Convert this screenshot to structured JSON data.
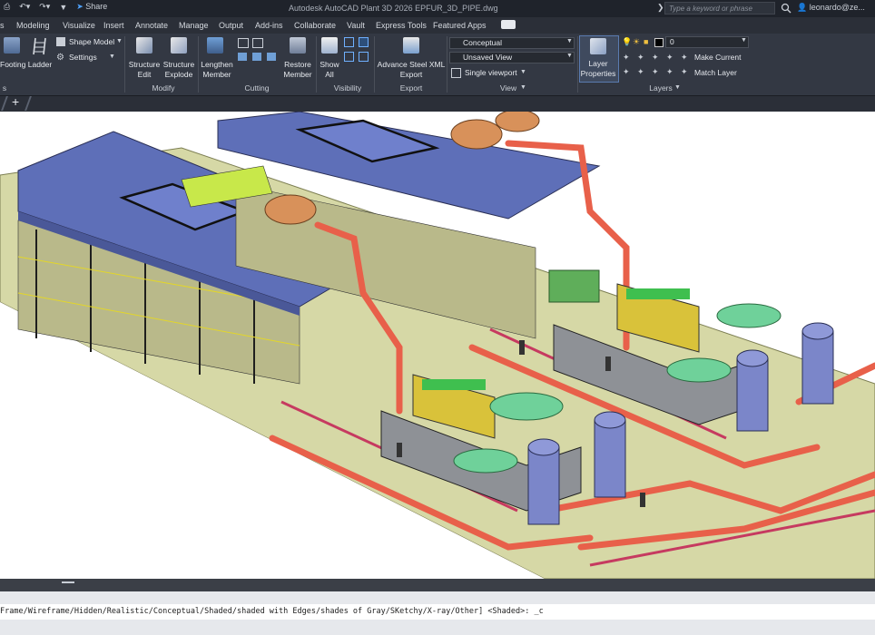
{
  "titlebar": {
    "share_label": "Share",
    "title": "Autodesk AutoCAD Plant 3D 2026    EPFUR_3D_PIPE.dwg",
    "search_placeholder": "Type a keyword or phrase",
    "user": "leonardo@ze..."
  },
  "tabs": [
    "s",
    "Modeling",
    "Visualize",
    "Insert",
    "Annotate",
    "Manage",
    "Output",
    "Add-ins",
    "Collaborate",
    "Vault",
    "Express Tools",
    "Featured Apps"
  ],
  "ribbon": {
    "footing": "Footing",
    "ladder": "Ladder",
    "shape_model": "Shape Model",
    "settings": "Settings",
    "structure_edit": "Structure\nEdit",
    "structure_explode": "Structure\nExplode",
    "modify_label": "Modify",
    "lengthen_member": "Lengthen\nMember",
    "restore_member": "Restore\nMember",
    "cutting_label": "Cutting",
    "show_all": "Show\nAll",
    "visibility_label": "Visibility",
    "advance_steel": "Advance Steel XML\nExport",
    "export_label": "Export",
    "visual_style": "Conceptual",
    "saved_view": "Unsaved View",
    "viewport_config": "Single viewport",
    "view_label": "View",
    "layer_properties": "Layer\nProperties",
    "layer_current": "0",
    "make_current": "Make Current",
    "match_layer": "Match Layer",
    "layers_label": "Layers",
    "left_panel_label": "s"
  },
  "doctabs": {
    "add": "+"
  },
  "command_line": "Frame/Wireframe/Hidden/Realistic/Conceptual/Shaded/shaded with Edges/shades of Gray/SKetchy/X-ray/Other] <Shaded>: _c",
  "colors": {
    "accent": "#4fa3ff",
    "pipe": "#e8604a",
    "roof": "#5e6fb8",
    "ground": "#d6d8a6",
    "equipment_green": "#6fd19a",
    "equipment_yellow": "#d9c23a",
    "tank": "#7b86c9"
  }
}
